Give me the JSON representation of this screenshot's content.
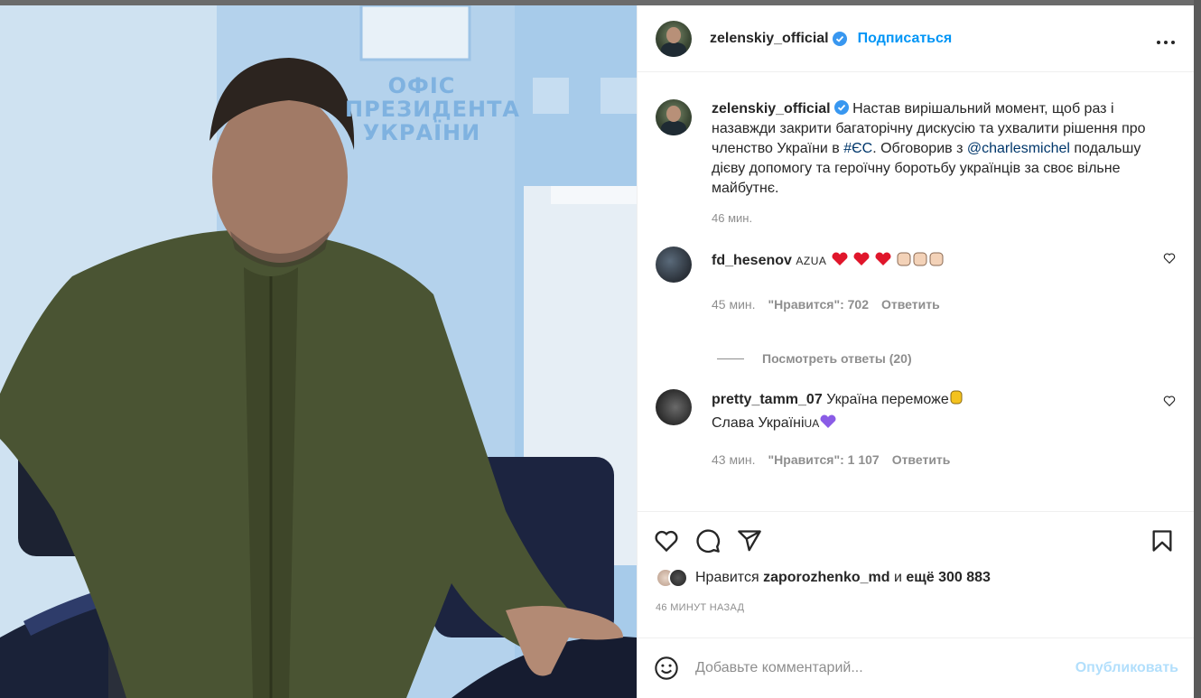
{
  "post": {
    "author": "zelenskiy_official",
    "follow_label": "Подписаться",
    "more_label": "•••",
    "caption_text": "Настав вирішальний момент, щоб раз і назавжди закрити багаторічну дискусію та ухвалити рішення про членство України в ",
    "hashtag": "#ЄС",
    "caption_mid": ". Обговорив з ",
    "mention": "@charlesmichel",
    "caption_end": " подальшу дієву допомогу та героїчну боротьбу українців за своє вільне майбутнє.",
    "caption_time": "46 мин."
  },
  "photo": {
    "wall_text": "ОФІС ПРЕЗИДЕНТА УКРАЇНИ"
  },
  "comments": [
    {
      "username": "fd_hesenov",
      "text": "AZUA",
      "emoji_hearts": 3,
      "emoji_hands": 3,
      "time": "45 мин.",
      "likes": "\"Нравится\": 702",
      "reply": "Ответить"
    },
    {
      "username": "pretty_tamm_07",
      "text": "Україна переможе",
      "line2": "Слава Україні",
      "line2_flag": "UA",
      "time": "43 мин.",
      "likes": "\"Нравится\": 1 107",
      "reply": "Ответить"
    }
  ],
  "replies_label": "Посмотреть ответы (20)",
  "likes": {
    "prefix": "Нравится",
    "user": "zaporozhenko_md",
    "and": "и",
    "rest": "ещё 300 883"
  },
  "post_time": "46 МИНУТ НАЗАД",
  "comment_box": {
    "placeholder": "Добавьте комментарий...",
    "publish": "Опубликовать"
  },
  "colors": {
    "accent": "#0095f6",
    "link": "#00376b",
    "muted": "#8e8e8e",
    "publish_disabled": "#b2dffc"
  },
  "icons": [
    "verified-badge-icon",
    "more-icon",
    "heart-icon",
    "comment-icon",
    "share-icon",
    "save-icon",
    "smile-icon"
  ]
}
